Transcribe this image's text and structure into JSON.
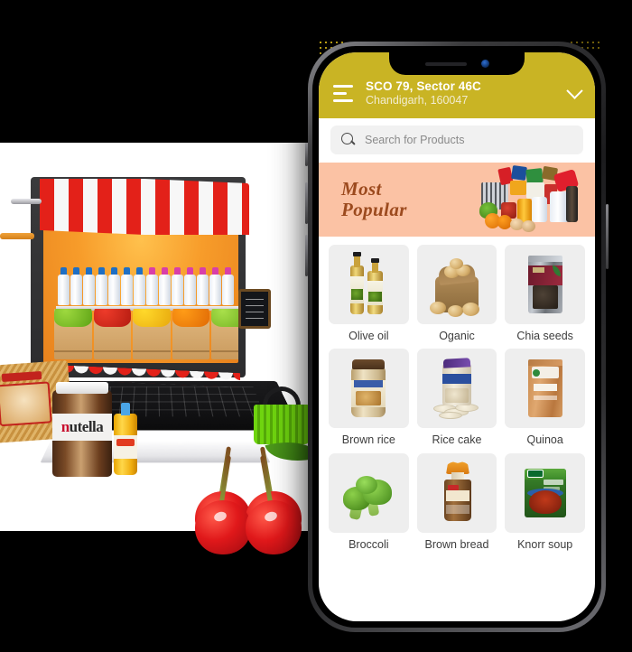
{
  "app": {
    "header": {
      "menu_icon": "hamburger-menu-icon",
      "address_line1": "SCO 79, Sector 46C",
      "address_line2": "Chandigarh, 160047",
      "dropdown_icon": "chevron-down-icon",
      "background_color": "#C9B424"
    },
    "search": {
      "icon": "search-icon",
      "placeholder": "Search for Products",
      "value": "",
      "background_color": "#F1F1F1"
    },
    "banner": {
      "title": "Most\nPopular",
      "background_color": "#FBC2A4",
      "text_color": "#9C4A1E",
      "art": "grocery-basket-assortment"
    },
    "products": [
      {
        "label": "Olive oil",
        "image": "olive-oil-bottles"
      },
      {
        "label": "Oganic",
        "image": "potato-sack"
      },
      {
        "label": "Chia seeds",
        "image": "chia-seeds-pouch"
      },
      {
        "label": "Brown rice",
        "image": "brown-rice-jar"
      },
      {
        "label": "Rice cake",
        "image": "rice-cake-pack"
      },
      {
        "label": "Quinoa",
        "image": "quinoa-pouch"
      },
      {
        "label": "Broccoli",
        "image": "broccoli-head"
      },
      {
        "label": "Brown bread",
        "image": "brown-bread-loaf"
      },
      {
        "label": "Knorr soup",
        "image": "knorr-soup-packet"
      }
    ]
  },
  "hero": {
    "scene": "grocery-market-stall-on-laptop",
    "elements": [
      "striped-awning-stall",
      "milk-bottle-shelf",
      "fruit-vegetable-crates",
      "chalkboard-menu",
      "green-shopping-basket",
      "laptop",
      "britannia-rusk-pack",
      "nutella-jar",
      "juice-bottle",
      "cherries"
    ],
    "nutella_label": "nutella",
    "background_color": "#FFFFFF"
  },
  "canvas": {
    "background_color": "#000000",
    "accent_dots_color": "#E8C519"
  }
}
